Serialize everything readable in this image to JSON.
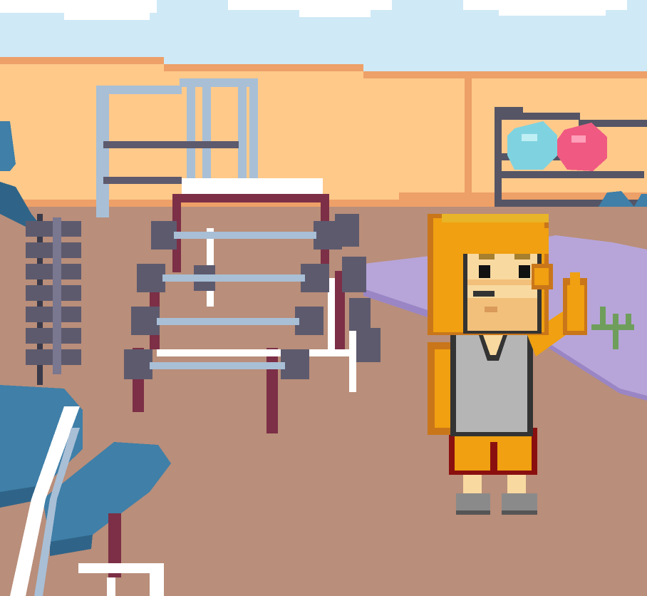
{
  "scene": {
    "name": "gym-interior",
    "palette": {
      "sky": "#cfe9f6",
      "cloud": "#ffffff",
      "wall": "#ffc98a",
      "wall_trim": "#eda068",
      "floor": "#b98e7a",
      "rug": "#b7a5d9",
      "rug_edge": "#9a86c5",
      "rack_frame": "#7c2f46",
      "metal": "#a8bfd6",
      "weight_plate": "#5d5a6e",
      "bench": "#3f7fa8",
      "bench_dark": "#2f6488",
      "ball_teal": "#7fd3e0",
      "ball_pink": "#f05a82",
      "skin": "#f8d9a0",
      "hair": "#f0a010",
      "tank_top": "#b5b5b5",
      "shorts": "#f0a010",
      "shorts_trim": "#8a1010",
      "shoe": "#8a8a8a",
      "plant": "#6f9e5c"
    },
    "objects": [
      {
        "name": "squat-rack",
        "icon": "rack-icon"
      },
      {
        "name": "dumbbell-rack",
        "icon": "dumbbell-rack-icon"
      },
      {
        "name": "weight-stack",
        "icon": "weight-stack-icon"
      },
      {
        "name": "weight-bench",
        "icon": "bench-icon"
      },
      {
        "name": "ball-rack",
        "icon": "ball-rack-icon"
      },
      {
        "name": "gym-character",
        "icon": "character-icon"
      }
    ]
  }
}
